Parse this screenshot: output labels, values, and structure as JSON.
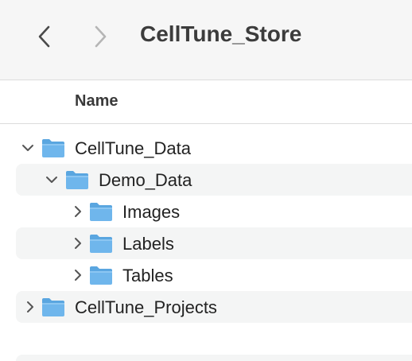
{
  "window": {
    "title": "CellTune_Store"
  },
  "toolbar": {
    "back_icon": "chevron-left-icon",
    "forward_icon": "chevron-right-icon"
  },
  "columns": {
    "name_header": "Name"
  },
  "colors": {
    "folder_body": "#6fb6ec",
    "folder_tab": "#5aa6e0",
    "stripe": "#f4f5f5",
    "toolbar_bg": "#f6f6f6"
  },
  "tree": {
    "items": [
      {
        "label": "CellTune_Data",
        "depth": 0,
        "expanded": true,
        "icon": "folder-icon"
      },
      {
        "label": "Demo_Data",
        "depth": 1,
        "expanded": true,
        "icon": "folder-icon"
      },
      {
        "label": "Images",
        "depth": 2,
        "expanded": false,
        "icon": "folder-icon"
      },
      {
        "label": "Labels",
        "depth": 2,
        "expanded": false,
        "icon": "folder-icon"
      },
      {
        "label": "Tables",
        "depth": 2,
        "expanded": false,
        "icon": "folder-icon"
      },
      {
        "label": "CellTune_Projects",
        "depth": 0,
        "expanded": false,
        "icon": "folder-icon"
      }
    ]
  }
}
